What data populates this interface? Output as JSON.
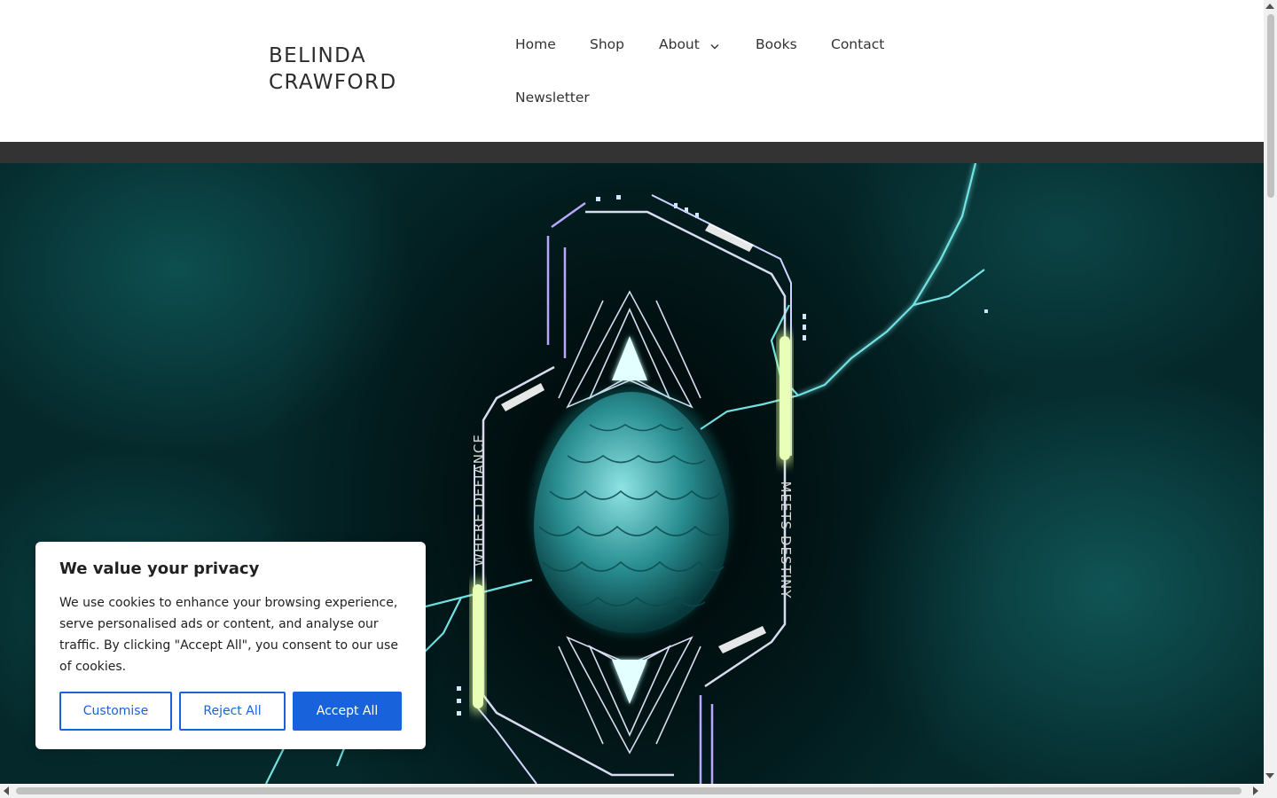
{
  "site": {
    "title": "BELINDA CRAWFORD"
  },
  "nav": {
    "items": [
      {
        "label": "Home"
      },
      {
        "label": "Shop"
      },
      {
        "label": "About",
        "icon": "chevron-down-icon"
      },
      {
        "label": "Books"
      },
      {
        "label": "Contact"
      },
      {
        "label": "Newsletter"
      }
    ]
  },
  "hero": {
    "text_left": "WHERE DEFIANCE",
    "text_right": "MEETS DESTINY",
    "colors": {
      "background": "#05292b",
      "accent": "#3fe6e6",
      "glow": "#dfff9a"
    }
  },
  "cookie": {
    "title": "We value your privacy",
    "text": "We use cookies to enhance your browsing experience, serve personalised ads or content, and analyse our traffic. By clicking \"Accept All\", you consent to our use of cookies.",
    "customise_label": "Customise",
    "reject_label": "Reject All",
    "accept_label": "Accept All",
    "accent_color": "#1863dc"
  }
}
